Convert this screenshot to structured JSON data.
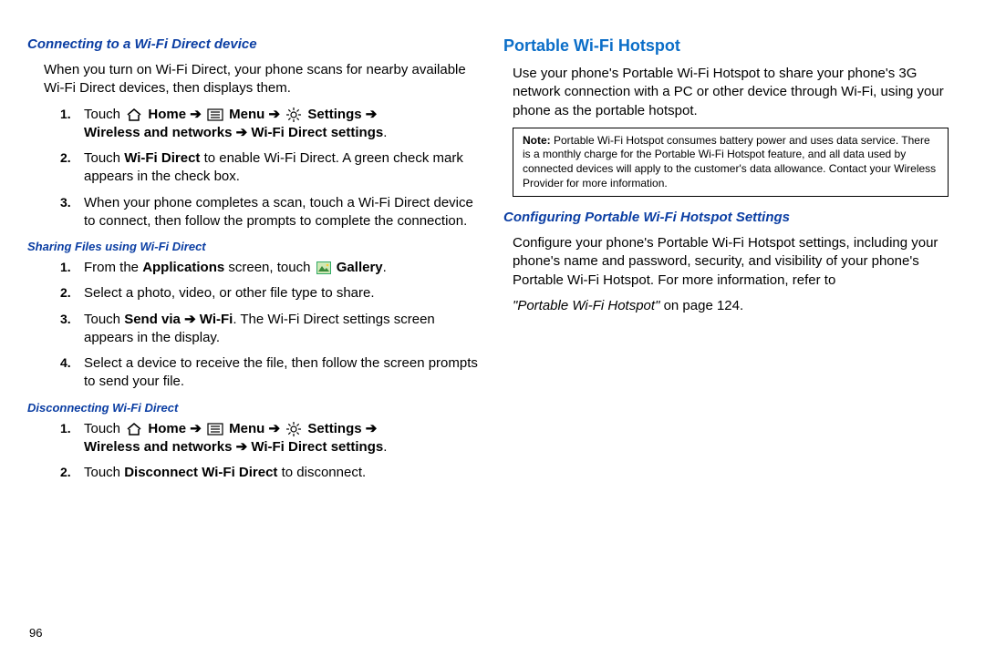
{
  "left": {
    "h1": "Connecting to a Wi-Fi Direct device",
    "intro": "When you turn on Wi-Fi Direct, your phone scans for nearby available Wi-Fi Direct devices, then displays them.",
    "s1_touch": "Touch ",
    "s1_home": "Home",
    "s1_arrow": " ➔ ",
    "s1_menu": "Menu",
    "s1_settings": "Settings",
    "s1_tail": "Wireless and networks ➔ Wi-Fi Direct settings",
    "s1_period": ".",
    "s2a": "Touch ",
    "s2b": "Wi-Fi Direct",
    "s2c": " to enable Wi-Fi Direct. A green check mark appears in the check box.",
    "s3": "When your phone completes a scan, touch a Wi-Fi Direct device to connect, then follow the prompts to complete the connection.",
    "h2": "Sharing Files using Wi-Fi Direct",
    "f1a": "From the ",
    "f1b": "Applications",
    "f1c": " screen, touch ",
    "f1_gallery": "Gallery",
    "f1_period": ".",
    "f2": "Select a photo, video, or other file type to share.",
    "f3a": "Touch ",
    "f3b": "Send via ➔ Wi-Fi",
    "f3c": ". The Wi-Fi Direct settings screen appears in the display.",
    "f4": "Select a device to receive the file, then follow the screen prompts to send your file.",
    "h3": "Disconnecting Wi-Fi Direct",
    "d2a": "Touch ",
    "d2b": "Disconnect Wi-Fi Direct",
    "d2c": " to disconnect."
  },
  "right": {
    "h1": "Portable Wi-Fi Hotspot",
    "p1": "Use your phone's Portable Wi-Fi Hotspot to share your phone's 3G network connection with a PC or other device through Wi-Fi, using your phone as the portable hotspot.",
    "note_label": "Note:",
    "note": " Portable Wi-Fi Hotspot consumes battery power and uses data service. There is a monthly charge for the Portable Wi-Fi Hotspot feature, and all data used by connected devices will apply to the customer's data allowance. Contact your Wireless Provider for more information.",
    "h2": "Configuring Portable Wi-Fi Hotspot Settings",
    "p2": "Configure your phone's Portable Wi-Fi Hotspot settings, including your phone's name and password, security, and visibility of your phone's Portable Wi-Fi Hotspot. For more information, refer to ",
    "xref_quote": "\"Portable Wi-Fi Hotspot\"",
    "xref_tail": " on page 124."
  },
  "pagenum": "96"
}
